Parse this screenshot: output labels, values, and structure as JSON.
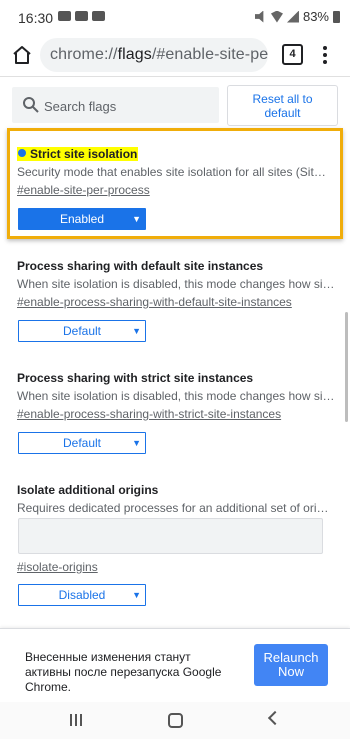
{
  "status_bar": {
    "time": "16:30",
    "battery": "83%"
  },
  "browser": {
    "url_prefix": "chrome://",
    "url_bold": "flags",
    "url_suffix": "/#enable-site-per",
    "tab_count": "4"
  },
  "search": {
    "placeholder": "Search flags"
  },
  "reset_button": {
    "label": "Reset all to default"
  },
  "flags": [
    {
      "title": "Strict site isolation",
      "description": "Security mode that enables site isolation for all sites (SitePer…",
      "link": "#enable-site-per-process",
      "value": "Enabled",
      "highlighted": true
    },
    {
      "title": "Process sharing with default site instances",
      "description": "When site isolation is disabled, this mode changes how sites…",
      "link": "#enable-process-sharing-with-default-site-instances",
      "value": "Default"
    },
    {
      "title": "Process sharing with strict site instances",
      "description": "When site isolation is disabled, this mode changes how sites…",
      "link": "#enable-process-sharing-with-strict-site-instances",
      "value": "Default"
    },
    {
      "title": "Isolate additional origins",
      "description": "Requires dedicated processes for an additional set of origins…",
      "link": "#isolate-origins",
      "value": "Disabled"
    }
  ],
  "relaunch": {
    "message": "Внесенные изменения станут активны после перезапуска Google Chrome.",
    "button": "Relaunch Now"
  },
  "colors": {
    "accent": "#1a73e8",
    "highlight_frame": "#f0ad0a",
    "title_highlight": "#ffff00"
  }
}
